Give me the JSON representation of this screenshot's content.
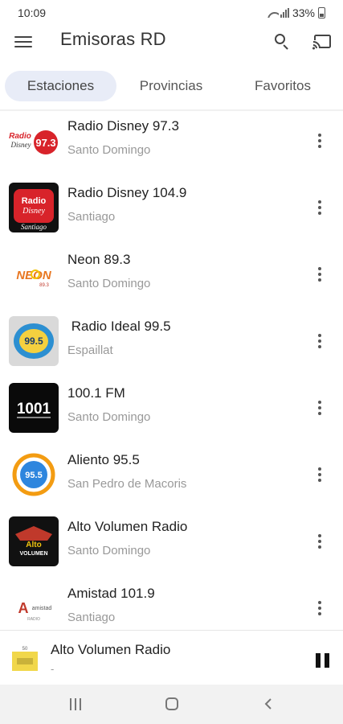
{
  "status_bar": {
    "time": "10:09",
    "battery": "33%"
  },
  "app_bar": {
    "title": "Emisoras RD",
    "menu_icon": "menu-icon",
    "search_icon": "search-icon",
    "cast_icon": "cast-icon"
  },
  "tabs": [
    {
      "label": "Estaciones",
      "active": true
    },
    {
      "label": "Provincias",
      "active": false
    },
    {
      "label": "Favoritos",
      "active": false
    }
  ],
  "stations": [
    {
      "name": "Radio Disney 97.3",
      "province": "Santo Domingo",
      "logo_text": "Radio Disney 97.3"
    },
    {
      "name": "Radio Disney 104.9",
      "province": "Santiago",
      "logo_text": "Radio Disney Santiago"
    },
    {
      "name": "Neon 89.3",
      "province": "Santo Domingo",
      "logo_text": "NEON 89.3"
    },
    {
      "name": " Radio Ideal 99.5",
      "province": "Espaillat",
      "logo_text": "99.5"
    },
    {
      "name": "100.1 FM",
      "province": "Santo Domingo",
      "logo_text": "1001"
    },
    {
      "name": "Aliento 95.5",
      "province": "San Pedro de Macoris",
      "logo_text": "95.5"
    },
    {
      "name": "Alto Volumen Radio",
      "province": "Santo Domingo",
      "logo_text": "Alto Volumen"
    },
    {
      "name": "Amistad 101.9",
      "province": "Santiago",
      "logo_text": "AMISTAD"
    }
  ],
  "player": {
    "title": "Alto Volumen Radio",
    "subtitle": "-",
    "state_icon": "pause-icon"
  },
  "nav": {
    "recent_icon": "recent-apps-icon",
    "home_icon": "home-icon",
    "back_icon": "back-icon"
  },
  "colors": {
    "tab_active_bg": "#e8ecf7",
    "disney_red": "#d8232a",
    "text_secondary": "#999999"
  }
}
